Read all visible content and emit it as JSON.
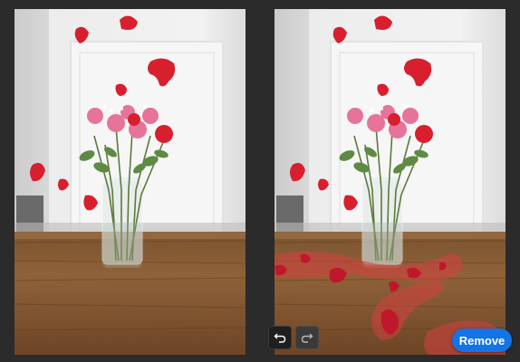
{
  "toolbar": {
    "undo_icon": "undo-icon",
    "redo_icon": "redo-icon",
    "remove_label": "Remove"
  },
  "colors": {
    "accent": "#1473e6",
    "petal": "#d81f2e",
    "brush_highlight": "#d64040"
  }
}
